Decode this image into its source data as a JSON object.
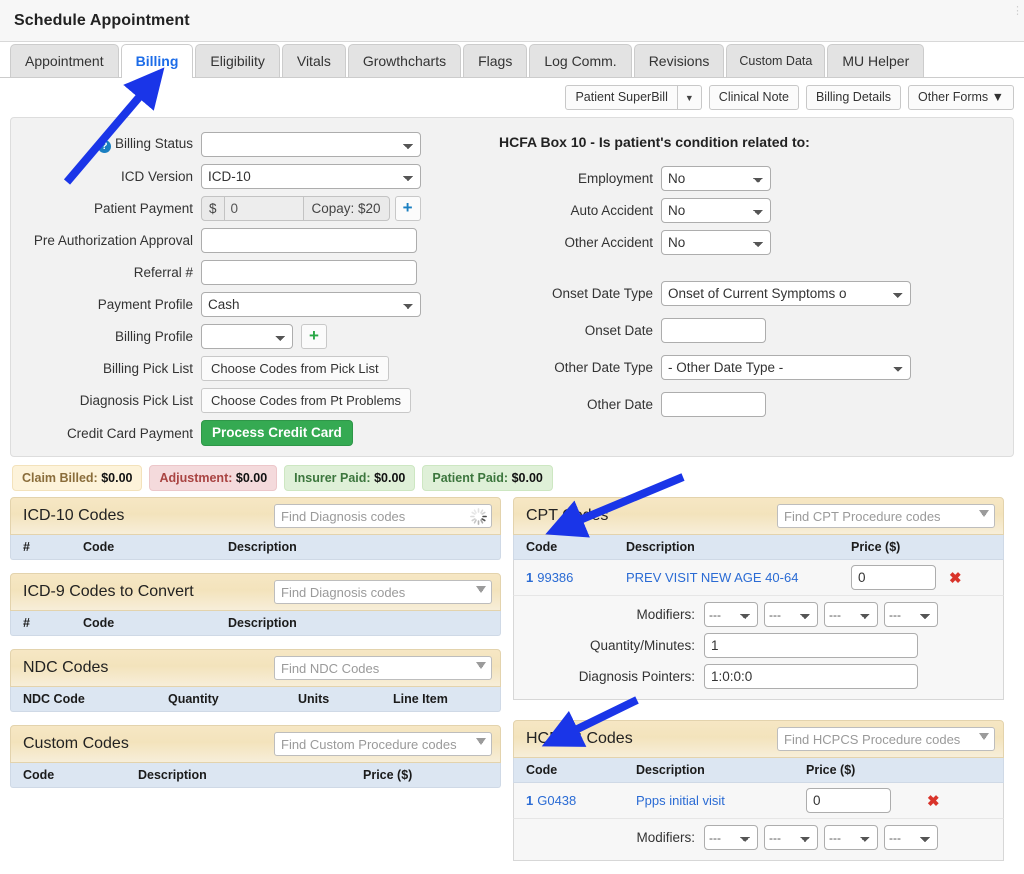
{
  "window": {
    "title": "Schedule Appointment"
  },
  "tabs": [
    {
      "label": "Appointment",
      "active": false
    },
    {
      "label": "Billing",
      "active": true
    },
    {
      "label": "Eligibility",
      "active": false
    },
    {
      "label": "Vitals",
      "active": false
    },
    {
      "label": "Growthcharts",
      "active": false
    },
    {
      "label": "Flags",
      "active": false
    },
    {
      "label": "Log Comm.",
      "active": false
    },
    {
      "label": "Revisions",
      "active": false
    },
    {
      "label": "Custom Data",
      "active": false
    },
    {
      "label": "MU Helper",
      "active": false
    }
  ],
  "actions": {
    "superbill": "Patient SuperBill",
    "superbill_caret": "▼",
    "clinical_note": "Clinical Note",
    "billing_details": "Billing Details",
    "other_forms": "Other Forms ▼"
  },
  "form_left": {
    "billing_status": {
      "label": "Billing Status",
      "value": "",
      "help": "?"
    },
    "icd_version": {
      "label": "ICD Version",
      "value": "ICD-10"
    },
    "patient_payment": {
      "label": "Patient Payment",
      "currency": "$",
      "amount": "0",
      "copay": "Copay: $20",
      "add": "+"
    },
    "pre_auth": {
      "label": "Pre Authorization Approval",
      "value": ""
    },
    "referral": {
      "label": "Referral #",
      "value": ""
    },
    "payment_profile": {
      "label": "Payment Profile",
      "value": "Cash"
    },
    "billing_profile": {
      "label": "Billing Profile",
      "value": "",
      "add": "+"
    },
    "billing_pick_list": {
      "label": "Billing Pick List",
      "button": "Choose Codes from Pick List"
    },
    "diagnosis_pick_list": {
      "label": "Diagnosis Pick List",
      "button": "Choose Codes from Pt Problems"
    },
    "credit_card": {
      "label": "Credit Card Payment",
      "button": "Process Credit Card"
    }
  },
  "form_right": {
    "heading": "HCFA Box 10 - Is patient's condition related to:",
    "employment": {
      "label": "Employment",
      "value": "No"
    },
    "auto_accident": {
      "label": "Auto Accident",
      "value": "No"
    },
    "other_accident": {
      "label": "Other Accident",
      "value": "No"
    },
    "onset_date_type": {
      "label": "Onset Date Type",
      "value": "Onset of Current Symptoms o"
    },
    "onset_date": {
      "label": "Onset Date",
      "value": ""
    },
    "other_date_type": {
      "label": "Other Date Type",
      "value": "- Other Date Type -"
    },
    "other_date": {
      "label": "Other Date",
      "value": ""
    }
  },
  "badges": [
    {
      "label": "Claim Billed:",
      "amount": "$0.00",
      "bg": "#fdf3da",
      "fg": "#8a6d3b",
      "border": "#f3e2bb"
    },
    {
      "label": "Adjustment:",
      "amount": "$0.00",
      "bg": "#f4dadc",
      "fg": "#a94442",
      "border": "#ecc7ca"
    },
    {
      "label": "Insurer Paid:",
      "amount": "$0.00",
      "bg": "#dff0d8",
      "fg": "#3c763d",
      "border": "#cde7c2"
    },
    {
      "label": "Patient Paid:",
      "amount": "$0.00",
      "bg": "#dff0d8",
      "fg": "#3c763d",
      "border": "#cde7c2"
    }
  ],
  "panels": {
    "icd10": {
      "title": "ICD-10 Codes",
      "search_placeholder": "Find Diagnosis codes",
      "search_icon": "spinner-icon",
      "columns": [
        "#",
        "Code",
        "Description"
      ],
      "rows": []
    },
    "icd9": {
      "title": "ICD-9 Codes to Convert",
      "search_placeholder": "Find Diagnosis codes",
      "search_icon": "dropdown-arrow-icon",
      "columns": [
        "#",
        "Code",
        "Description"
      ],
      "rows": []
    },
    "ndc": {
      "title": "NDC Codes",
      "search_placeholder": "Find NDC Codes",
      "search_icon": "dropdown-arrow-icon",
      "columns": [
        "NDC Code",
        "Quantity",
        "Units",
        "Line Item"
      ],
      "rows": []
    },
    "custom": {
      "title": "Custom Codes",
      "search_placeholder": "Find Custom Procedure codes",
      "search_icon": "dropdown-arrow-icon",
      "columns": [
        "Code",
        "Description",
        "Price ($)"
      ],
      "rows": []
    },
    "cpt": {
      "title": "CPT Codes",
      "search_placeholder": "Find CPT Procedure codes",
      "search_icon": "dropdown-arrow-icon",
      "columns": [
        "Code",
        "Description",
        "Price ($)"
      ],
      "row": {
        "index": "1",
        "code": "99386",
        "description": "PREV VISIT NEW AGE 40-64",
        "price": "0",
        "delete": "✖"
      },
      "detail": {
        "modifiers_label": "Modifiers:",
        "modifier_values": [
          "---",
          "---",
          "---",
          "---"
        ],
        "quantity_label": "Quantity/Minutes:",
        "quantity_value": "1",
        "pointers_label": "Diagnosis Pointers:",
        "pointers_value": "1:0:0:0"
      }
    },
    "hcpcs": {
      "title": "HCPCS Codes",
      "search_placeholder": "Find HCPCS Procedure codes",
      "search_icon": "dropdown-arrow-icon",
      "columns": [
        "Code",
        "Description",
        "Price ($)"
      ],
      "row": {
        "index": "1",
        "code": "G0438",
        "description": "Ppps initial visit",
        "price": "0",
        "delete": "✖"
      },
      "detail": {
        "modifiers_label": "Modifiers:",
        "modifier_values": [
          "---",
          "---",
          "---",
          "---"
        ]
      }
    }
  },
  "annotations": {
    "color": "#1a35e8",
    "arrows": [
      {
        "name": "arrow-to-billing-tab",
        "target": "Billing tab"
      },
      {
        "name": "arrow-to-cpt-codes",
        "target": "CPT Codes panel"
      },
      {
        "name": "arrow-to-hcpcs-codes",
        "target": "HCPCS Codes panel"
      }
    ]
  }
}
